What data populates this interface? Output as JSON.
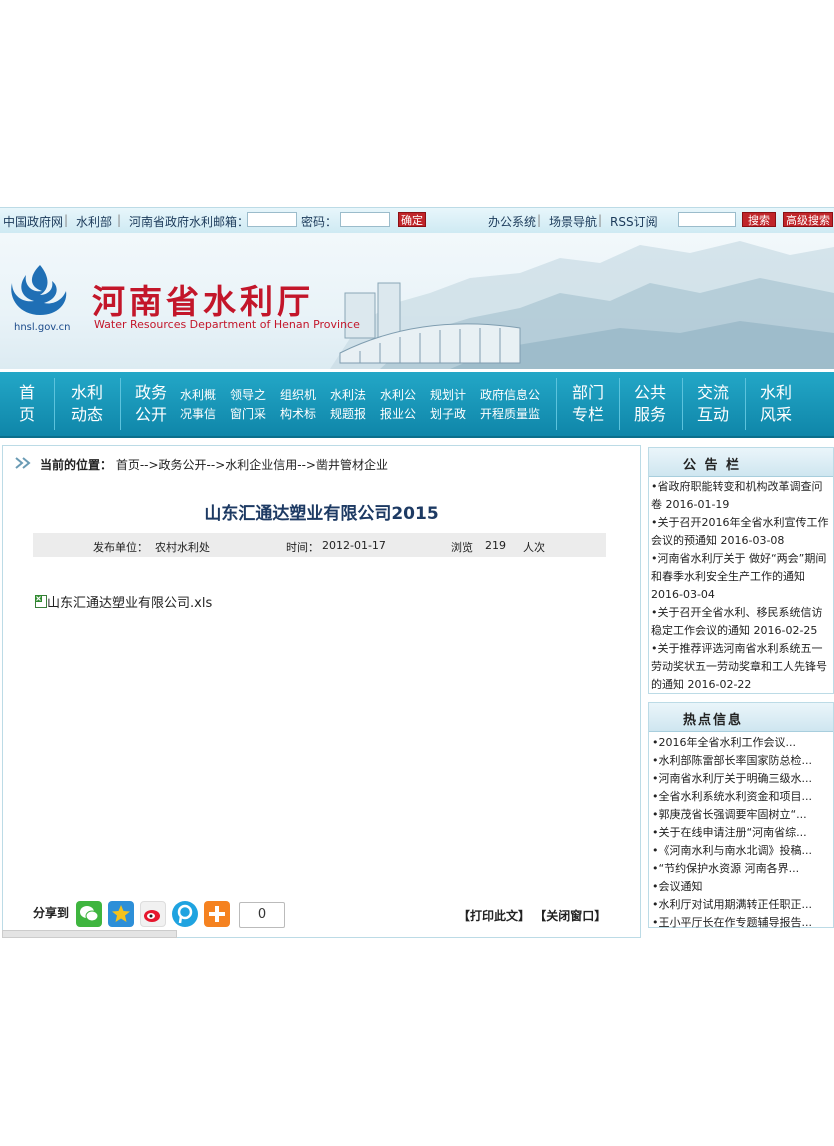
{
  "topbar": {
    "links": [
      "中国政府网",
      "水利部",
      "河南省政府",
      "水利邮箱："
    ],
    "password_label": "密码：",
    "confirm_label": "确定",
    "right_links": [
      "办公系统",
      "场景导航",
      "RSS订阅"
    ],
    "search_label": "搜索",
    "advanced_search_label": "高级搜索"
  },
  "banner": {
    "title_cn": "河南省水利厅",
    "title_en": "Water Resources Department of Henan Province",
    "site_domain": "hnsl.gov.cn"
  },
  "nav": {
    "main_items": [
      [
        "首",
        "页"
      ],
      [
        "水利",
        "动态"
      ],
      [
        "政务",
        "公开"
      ]
    ],
    "sub_items": [
      [
        "水利概",
        "况事信"
      ],
      [
        "领导之",
        "窗门采"
      ],
      [
        "组织机",
        "构术标"
      ],
      [
        "水利法",
        "规题报"
      ],
      [
        "水利公",
        "报业公"
      ],
      [
        "规划计",
        "划子政"
      ],
      [
        "政府信息公",
        "开程质量监"
      ]
    ],
    "right_items": [
      [
        "部门",
        "专栏"
      ],
      [
        "公共",
        "服务"
      ],
      [
        "交流",
        "互动"
      ],
      [
        "水利",
        "风采"
      ]
    ]
  },
  "breadcrumb": {
    "label": "当前的位置：",
    "path": "首页-->政务公开-->水利企业信用-->凿井管材企业"
  },
  "article": {
    "title": "山东汇通达塑业有限公司2015",
    "publisher_label": "发布单位：",
    "publisher": "农村水利处",
    "time_label": "时间：",
    "time": "2012-01-17",
    "views_label": "浏览",
    "views": "219",
    "views_unit": "人次",
    "attachment": "山东汇通达塑业有限公司.xls"
  },
  "share": {
    "label": "分享到",
    "count": "0",
    "print_label": "【打印此文】",
    "close_label": "【关闭窗口】"
  },
  "notice_board": {
    "title": "公 告 栏",
    "items": [
      "•省政府职能转变和机构改革调查问卷 2016-01-19",
      "•关于召开2016年全省水利宣传工作会议的预通知 2016-03-08",
      "•河南省水利厅关于 做好“两会”期间和春季水利安全生产工作的通知 2016-03-04",
      "•关于召开全省水利、移民系统信访稳定工作会议的通知 2016-02-25",
      "•关于推荐评选河南省水利系统五一劳动奖状五一劳动奖章和工人先锋号的通知 2016-02-22"
    ]
  },
  "hot_info": {
    "title": "热点信息",
    "items": [
      "•2016年全省水利工作会议...",
      "•水利部陈雷部长率国家防总检...",
      "•河南省水利厅关于明确三级水...",
      "•全省水利系统水利资金和项目...",
      "•郭庚茂省长强调要牢固树立“...",
      "•关于在线申请注册“河南省综...",
      "•《河南水利与南水北调》投稿...",
      "•“节约保护水资源 河南各界...",
      "•会议通知",
      "•水利厅对试用期满转正任职正...",
      "•王小平厅长在作专题辅导报告..."
    ]
  },
  "colors": {
    "nav_blue": "#1797b9",
    "title_red": "#c3162a",
    "button_red": "#c0252a"
  }
}
